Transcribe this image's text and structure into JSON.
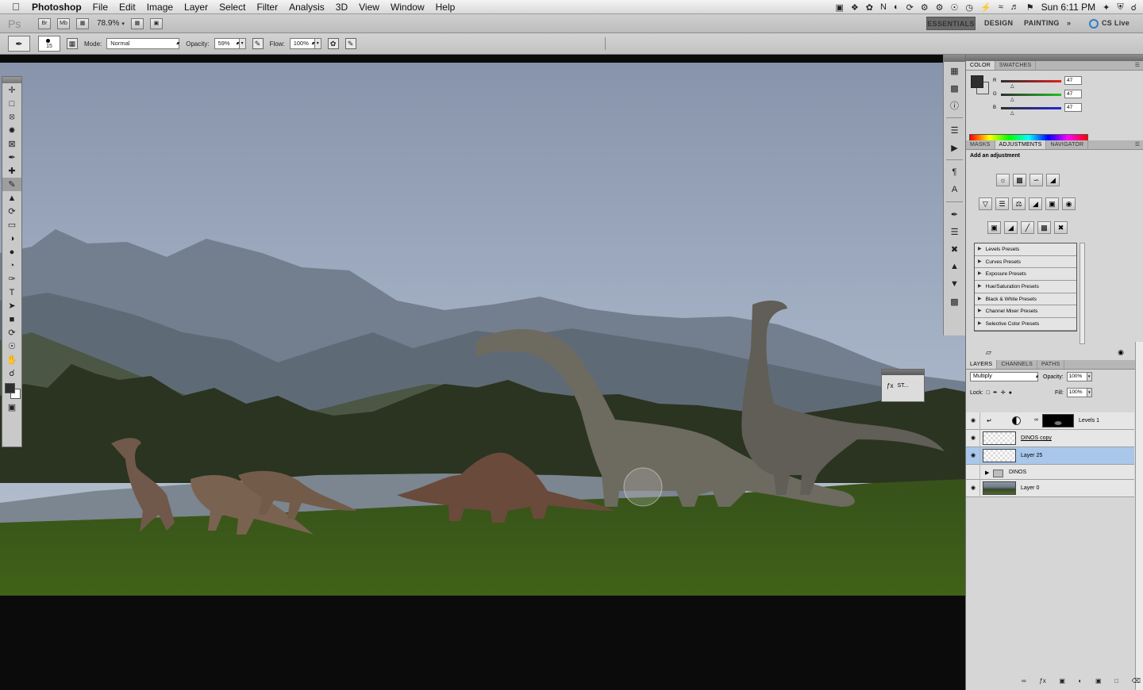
{
  "menubar": {
    "app_name": "Photoshop",
    "menus": [
      "File",
      "Edit",
      "Image",
      "Layer",
      "Select",
      "Filter",
      "Analysis",
      "3D",
      "View",
      "Window",
      "Help"
    ],
    "clock": "Sun 6:11 PM"
  },
  "appbar": {
    "logo": "Ps",
    "br_label": "Br",
    "mb_label": "Mb",
    "zoom": "78.9%",
    "workspaces": {
      "essentials": "ESSENTIALS",
      "design": "DESIGN",
      "painting": "PAINTING",
      "more": "»",
      "cs_live": "CS Live"
    }
  },
  "options": {
    "brush_size": "15",
    "mode_label": "Mode:",
    "mode_value": "Normal",
    "opacity_label": "Opacity:",
    "opacity_value": "59%",
    "flow_label": "Flow:",
    "flow_value": "100%"
  },
  "styles_float": {
    "label": "ST..."
  },
  "color_panel": {
    "tabs": [
      "COLOR",
      "SWATCHES"
    ],
    "r_label": "R",
    "g_label": "G",
    "b_label": "B",
    "r": "47",
    "g": "47",
    "b": "47",
    "fg_color": "#2f2f2f"
  },
  "adjustments_panel": {
    "tabs": [
      "MASKS",
      "ADJUSTMENTS",
      "NAVIGATOR"
    ],
    "title": "Add an adjustment",
    "presets": [
      "Levels Presets",
      "Curves Presets",
      "Exposure Presets",
      "Hue/Saturation Presets",
      "Black & White Presets",
      "Channel Mixer Presets",
      "Selective Color Presets"
    ]
  },
  "layers_panel": {
    "tabs": [
      "LAYERS",
      "CHANNELS",
      "PATHS"
    ],
    "blend_mode": "Multiply",
    "opacity_label": "Opacity:",
    "opacity_value": "100%",
    "lock_label": "Lock:",
    "fill_label": "Fill:",
    "fill_value": "100%",
    "layers": [
      {
        "name": "Levels 1",
        "visible": true,
        "type": "adjustment"
      },
      {
        "name": "DINOS copy",
        "visible": true,
        "type": "layer"
      },
      {
        "name": "Layer 25",
        "visible": true,
        "type": "layer",
        "selected": true
      },
      {
        "name": "DINOS",
        "visible": false,
        "type": "group"
      },
      {
        "name": "Layer 0",
        "visible": true,
        "type": "photo"
      }
    ],
    "selection_color": "#a9c7ea"
  }
}
